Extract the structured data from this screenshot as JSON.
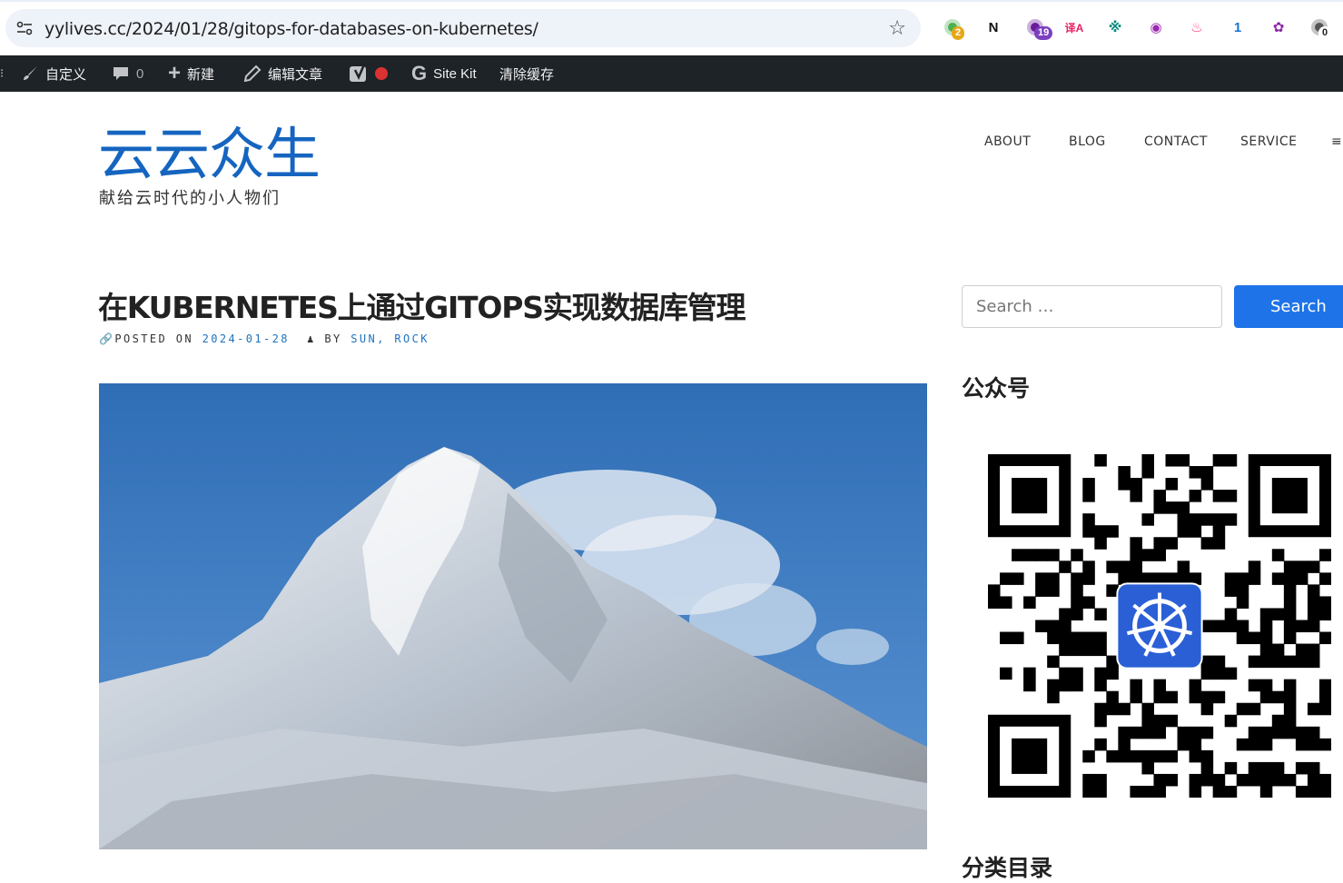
{
  "browser": {
    "url": "yylives.cc/2024/01/28/gitops-for-databases-on-kubernetes/",
    "extensions": [
      {
        "name": "extension-1",
        "badge": "2",
        "color": "#4caf50",
        "badge_color": "#e6a817"
      },
      {
        "name": "notion",
        "glyph": "N",
        "color": "#111111"
      },
      {
        "name": "extension-3",
        "badge": "19",
        "color": "#6a1b9a",
        "badge_color": "#7b3fbf"
      },
      {
        "name": "translate",
        "glyph": "译A",
        "color": "#e91e63"
      },
      {
        "name": "extension-5",
        "glyph": "※",
        "color": "#00897b"
      },
      {
        "name": "extension-6",
        "glyph": "◉",
        "color": "#9c27b0"
      },
      {
        "name": "extension-7",
        "glyph": "♨",
        "color": "#ff4081"
      },
      {
        "name": "extension-8",
        "glyph": "1",
        "color": "#1976d2"
      },
      {
        "name": "openai",
        "glyph": "✿",
        "color": "#8e24aa"
      },
      {
        "name": "extension-10",
        "badge": "0",
        "color": "#555555",
        "badge_color": "#ffffff"
      }
    ]
  },
  "adminbar": {
    "customize": "自定义",
    "comments_count": "0",
    "new": "新建",
    "edit": "编辑文章",
    "site_kit": "Site Kit",
    "clear_cache": "清除缓存"
  },
  "site": {
    "title": "云云众生",
    "description": "献给云时代的小人物们"
  },
  "nav": {
    "about": "ABOUT",
    "blog": "BLOG",
    "contact": "CONTACT",
    "service": "SERVICE",
    "menu": "≡"
  },
  "post": {
    "title": "在KUBERNETES上通过GITOPS实现数据库管理",
    "posted_on_label": "POSTED ON",
    "date": "2024-01-28",
    "by_label": "BY",
    "author": "SUN, ROCK"
  },
  "sidebar": {
    "search_placeholder": "Search …",
    "search_button": "Search",
    "widget_wechat": "公众号",
    "widget_categories": "分类目录"
  },
  "colors": {
    "accent": "#1e73e8",
    "site_title": "#1565c0",
    "adminbar": "#1d2327"
  }
}
